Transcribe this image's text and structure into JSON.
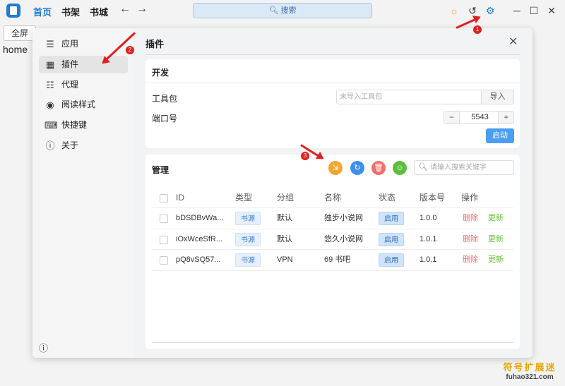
{
  "topbar": {
    "nav": [
      "首页",
      "书架",
      "书城"
    ],
    "search_label": "搜索",
    "icons": [
      "sun-icon",
      "history-icon",
      "settings-icon"
    ],
    "window_controls": [
      "minimize-icon",
      "maximize-icon",
      "close-icon"
    ]
  },
  "page": {
    "fullscreen_label": "全屏",
    "home_text": "home"
  },
  "sidebar": {
    "items": [
      {
        "label": "应用",
        "icon": "sliders-icon"
      },
      {
        "label": "插件",
        "icon": "grid-icon"
      },
      {
        "label": "代理",
        "icon": "network-icon"
      },
      {
        "label": "阅读样式",
        "icon": "palette-icon"
      },
      {
        "label": "快捷键",
        "icon": "keyboard-icon"
      },
      {
        "label": "关于",
        "icon": "info-icon"
      }
    ],
    "active_index": 1
  },
  "main": {
    "title": "插件",
    "dev": {
      "title": "开发",
      "toolkit_label": "工具包",
      "toolkit_placeholder": "未导入工具包",
      "import_label": "导入",
      "port_label": "端口号",
      "port_value": "5543",
      "minus": "−",
      "plus": "+",
      "start_label": "启动"
    },
    "mgmt": {
      "title": "管理",
      "search_placeholder": "请输入搜索关键字",
      "buttons": [
        {
          "icon": "import-icon",
          "color": "#f0a732"
        },
        {
          "icon": "refresh-icon",
          "color": "#3d8ff0"
        },
        {
          "icon": "delete-icon",
          "color": "#f56c6c"
        },
        {
          "icon": "smile-icon",
          "color": "#5cbf3b"
        }
      ],
      "columns": [
        "ID",
        "类型",
        "分组",
        "名称",
        "状态",
        "版本号",
        "操作"
      ],
      "rows": [
        {
          "id": "bDSDBvWa...",
          "type": "书源",
          "group": "默认",
          "name": "独步小说网",
          "status": "启用",
          "version": "1.0.0",
          "del": "删除",
          "upd": "更新"
        },
        {
          "id": "iOxWceSfR...",
          "type": "书源",
          "group": "默认",
          "name": "悠久小说网",
          "status": "启用",
          "version": "1.0.1",
          "del": "删除",
          "upd": "更新"
        },
        {
          "id": "pQ8vSQ57...",
          "type": "书源",
          "group": "VPN",
          "name": "69 书吧",
          "status": "启用",
          "version": "1.0.1",
          "del": "删除",
          "upd": "更新"
        }
      ]
    }
  },
  "annotations": [
    "1",
    "2",
    "3"
  ],
  "watermark": {
    "cn": "符号扩展迷",
    "en": "fuhao321.com"
  },
  "colors": {
    "accent": "#1e7cd8",
    "primary_button": "#4a9ef0",
    "annotation": "#e02020"
  }
}
